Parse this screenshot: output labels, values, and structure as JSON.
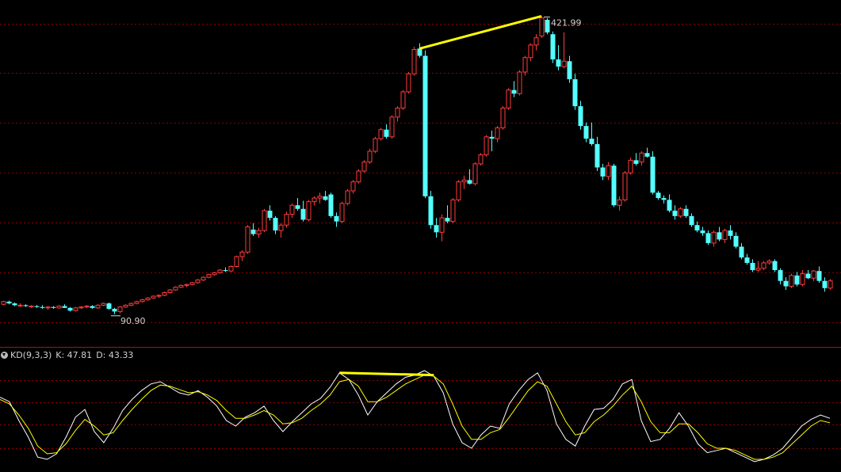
{
  "indicator": {
    "name": "KD(9,3,3)",
    "k_label": "K: 47.81",
    "d_label": "D: 43.33"
  },
  "colors": {
    "background": "#000000",
    "up": "#ff3c3c",
    "down": "#54ffff",
    "grid": "#8c0000",
    "separator": "#b01010",
    "trendline": "#ffff00",
    "k_line": "#ffffff",
    "d_line": "#ffff00",
    "label": "#d0d0d0"
  },
  "chart_data": [
    {
      "type": "candlestick",
      "title": "",
      "ylim": [
        60,
        440
      ],
      "grid": "dotted horizontal",
      "annotations": [
        {
          "text": "421.99",
          "kind": "max",
          "x": 97
        },
        {
          "text": "90.90",
          "kind": "min",
          "x": 20
        }
      ],
      "trendline": {
        "from": [
          75,
          386
        ],
        "to": [
          97,
          422
        ]
      },
      "candles": [
        [
          0,
          102,
          106,
          101,
          105
        ],
        [
          1,
          105,
          106,
          102,
          103
        ],
        [
          2,
          103,
          104,
          100,
          101
        ],
        [
          3,
          101,
          103,
          99,
          101
        ],
        [
          4,
          101,
          102,
          99,
          100
        ],
        [
          5,
          100,
          101,
          98,
          100
        ],
        [
          6,
          100,
          101,
          98,
          99
        ],
        [
          7,
          99,
          101,
          97,
          98
        ],
        [
          8,
          98,
          100,
          96,
          99
        ],
        [
          9,
          99,
          100,
          97,
          98
        ],
        [
          10,
          98,
          101,
          97,
          100
        ],
        [
          11,
          100,
          102,
          98,
          98
        ],
        [
          12,
          98,
          99,
          94,
          95
        ],
        [
          13,
          95,
          99,
          94,
          98
        ],
        [
          14,
          98,
          100,
          97,
          99
        ],
        [
          15,
          99,
          101,
          98,
          100
        ],
        [
          16,
          100,
          101,
          97,
          98
        ],
        [
          17,
          98,
          102,
          97,
          101
        ],
        [
          18,
          101,
          104,
          100,
          103
        ],
        [
          19,
          103,
          104,
          96,
          97
        ],
        [
          20,
          97,
          98,
          91,
          94
        ],
        [
          21,
          94,
          100,
          92,
          99
        ],
        [
          22,
          99,
          102,
          98,
          101
        ],
        [
          23,
          101,
          104,
          100,
          103
        ],
        [
          24,
          103,
          106,
          102,
          105
        ],
        [
          25,
          105,
          108,
          104,
          107
        ],
        [
          26,
          107,
          110,
          106,
          109
        ],
        [
          27,
          109,
          112,
          108,
          111
        ],
        [
          28,
          111,
          113,
          109,
          112
        ],
        [
          29,
          112,
          116,
          111,
          115
        ],
        [
          30,
          115,
          119,
          114,
          118
        ],
        [
          31,
          118,
          122,
          117,
          121
        ],
        [
          32,
          121,
          124,
          120,
          123
        ],
        [
          33,
          123,
          125,
          121,
          124
        ],
        [
          34,
          124,
          127,
          123,
          126
        ],
        [
          35,
          126,
          130,
          125,
          129
        ],
        [
          36,
          129,
          133,
          128,
          132
        ],
        [
          37,
          132,
          136,
          131,
          135
        ],
        [
          38,
          135,
          138,
          134,
          137
        ],
        [
          39,
          137,
          141,
          136,
          140
        ],
        [
          40,
          140,
          143,
          138,
          139
        ],
        [
          41,
          139,
          145,
          138,
          144
        ],
        [
          42,
          144,
          156,
          143,
          155
        ],
        [
          43,
          155,
          162,
          150,
          160
        ],
        [
          44,
          160,
          190,
          158,
          188
        ],
        [
          45,
          185,
          192,
          178,
          180
        ],
        [
          46,
          180,
          187,
          176,
          184
        ],
        [
          47,
          184,
          208,
          182,
          206
        ],
        [
          48,
          206,
          212,
          195,
          198
        ],
        [
          49,
          198,
          200,
          180,
          184
        ],
        [
          50,
          184,
          192,
          176,
          190
        ],
        [
          51,
          190,
          205,
          187,
          202
        ],
        [
          52,
          202,
          214,
          198,
          212
        ],
        [
          53,
          212,
          220,
          206,
          208
        ],
        [
          54,
          208,
          217,
          194,
          196
        ],
        [
          55,
          196,
          218,
          194,
          216
        ],
        [
          56,
          216,
          222,
          212,
          220
        ],
        [
          57,
          220,
          226,
          214,
          222
        ],
        [
          58,
          222,
          228,
          217,
          218
        ],
        [
          59,
          224,
          226,
          198,
          200
        ],
        [
          60,
          200,
          204,
          188,
          194
        ],
        [
          61,
          194,
          216,
          192,
          214
        ],
        [
          62,
          214,
          230,
          212,
          228
        ],
        [
          63,
          228,
          240,
          225,
          238
        ],
        [
          64,
          238,
          252,
          236,
          250
        ],
        [
          65,
          250,
          262,
          248,
          260
        ],
        [
          66,
          260,
          275,
          258,
          272
        ],
        [
          67,
          272,
          288,
          270,
          286
        ],
        [
          68,
          286,
          298,
          284,
          296
        ],
        [
          69,
          296,
          302,
          286,
          288
        ],
        [
          70,
          288,
          312,
          286,
          310
        ],
        [
          71,
          310,
          322,
          305,
          320
        ],
        [
          72,
          320,
          340,
          318,
          338
        ],
        [
          73,
          338,
          360,
          336,
          358
        ],
        [
          74,
          358,
          388,
          356,
          385
        ],
        [
          75,
          386,
          392,
          376,
          378
        ],
        [
          76,
          378,
          384,
          220,
          222
        ],
        [
          77,
          222,
          228,
          186,
          190
        ],
        [
          78,
          190,
          198,
          176,
          182
        ],
        [
          79,
          182,
          202,
          172,
          198
        ],
        [
          80,
          198,
          212,
          192,
          194
        ],
        [
          81,
          194,
          220,
          192,
          218
        ],
        [
          82,
          218,
          240,
          216,
          238
        ],
        [
          83,
          238,
          245,
          230,
          240
        ],
        [
          84,
          240,
          252,
          235,
          236
        ],
        [
          85,
          236,
          260,
          234,
          258
        ],
        [
          86,
          258,
          270,
          256,
          268
        ],
        [
          87,
          268,
          290,
          266,
          288
        ],
        [
          88,
          288,
          295,
          272,
          286
        ],
        [
          89,
          286,
          300,
          282,
          298
        ],
        [
          90,
          298,
          322,
          296,
          320
        ],
        [
          91,
          320,
          342,
          318,
          340
        ],
        [
          92,
          340,
          350,
          332,
          336
        ],
        [
          93,
          336,
          362,
          334,
          360
        ],
        [
          94,
          360,
          378,
          356,
          376
        ],
        [
          95,
          376,
          392,
          372,
          390
        ],
        [
          96,
          390,
          402,
          384,
          398
        ],
        [
          97,
          400,
          422,
          398,
          420
        ],
        [
          98,
          418,
          420,
          402,
          404
        ],
        [
          99,
          402,
          405,
          370,
          374
        ],
        [
          100,
          374,
          390,
          362,
          366
        ],
        [
          101,
          366,
          404,
          364,
          372
        ],
        [
          102,
          372,
          378,
          348,
          352
        ],
        [
          103,
          352,
          358,
          318,
          322
        ],
        [
          104,
          322,
          328,
          296,
          300
        ],
        [
          105,
          300,
          304,
          282,
          286
        ],
        [
          106,
          286,
          304,
          278,
          280
        ],
        [
          107,
          280,
          288,
          250,
          254
        ],
        [
          108,
          254,
          258,
          240,
          244
        ],
        [
          109,
          244,
          260,
          240,
          256
        ],
        [
          110,
          256,
          258,
          210,
          212
        ],
        [
          111,
          212,
          222,
          206,
          218
        ],
        [
          112,
          218,
          250,
          216,
          248
        ],
        [
          113,
          248,
          265,
          246,
          262
        ],
        [
          114,
          262,
          270,
          256,
          258
        ],
        [
          115,
          260,
          272,
          256,
          270
        ],
        [
          116,
          270,
          276,
          265,
          266
        ],
        [
          117,
          266,
          272,
          224,
          226
        ],
        [
          118,
          226,
          228,
          218,
          220
        ],
        [
          119,
          220,
          223,
          214,
          218
        ],
        [
          120,
          218,
          224,
          204,
          206
        ],
        [
          121,
          206,
          212,
          196,
          200
        ],
        [
          122,
          200,
          210,
          198,
          208
        ],
        [
          123,
          208,
          212,
          198,
          200
        ],
        [
          124,
          200,
          203,
          188,
          190
        ],
        [
          125,
          190,
          194,
          182,
          184
        ],
        [
          126,
          184,
          188,
          178,
          181
        ],
        [
          127,
          181,
          184,
          168,
          170
        ],
        [
          128,
          170,
          184,
          166,
          182
        ],
        [
          129,
          182,
          188,
          172,
          174
        ],
        [
          130,
          174,
          186,
          170,
          184
        ],
        [
          131,
          184,
          190,
          174,
          178
        ],
        [
          132,
          178,
          182,
          164,
          166
        ],
        [
          133,
          166,
          170,
          152,
          154
        ],
        [
          134,
          154,
          158,
          146,
          148
        ],
        [
          135,
          148,
          152,
          138,
          140
        ],
        [
          136,
          140,
          150,
          138,
          142
        ],
        [
          137,
          142,
          150,
          140,
          148
        ],
        [
          138,
          148,
          152,
          146,
          150
        ],
        [
          139,
          150,
          152,
          138,
          140
        ],
        [
          140,
          140,
          142,
          124,
          128
        ],
        [
          141,
          128,
          132,
          118,
          122
        ],
        [
          142,
          122,
          136,
          120,
          134
        ],
        [
          143,
          134,
          138,
          122,
          124
        ],
        [
          144,
          124,
          140,
          122,
          136
        ],
        [
          145,
          136,
          140,
          130,
          131
        ],
        [
          146,
          131,
          140,
          128,
          139
        ],
        [
          147,
          139,
          144,
          126,
          128
        ],
        [
          148,
          128,
          132,
          116,
          120
        ],
        [
          149,
          120,
          130,
          118,
          128
        ]
      ]
    },
    {
      "type": "line",
      "title": "KD(9,3,3)",
      "ylim": [
        0,
        100
      ],
      "series": [
        {
          "name": "K",
          "values": [
            66,
            62,
            45,
            30,
            12,
            10,
            15,
            30,
            48,
            55,
            35,
            25,
            38,
            54,
            64,
            72,
            78,
            80,
            75,
            70,
            68,
            72,
            66,
            58,
            45,
            40,
            48,
            52,
            58,
            45,
            35,
            44,
            52,
            60,
            65,
            75,
            88,
            82,
            68,
            50,
            62,
            70,
            78,
            84,
            86,
            90,
            85,
            70,
            42,
            25,
            20,
            32,
            40,
            38,
            60,
            72,
            82,
            88,
            72,
            42,
            28,
            22,
            40,
            55,
            56,
            64,
            78,
            82,
            45,
            26,
            28,
            38,
            52,
            40,
            24,
            16,
            18,
            20,
            16,
            12,
            8,
            10,
            14,
            20,
            30,
            40,
            46,
            50,
            47
          ]
        },
        {
          "name": "D",
          "values": [
            64,
            60,
            50,
            38,
            22,
            15,
            16,
            24,
            36,
            46,
            40,
            32,
            34,
            45,
            55,
            64,
            72,
            77,
            76,
            73,
            70,
            71,
            68,
            63,
            54,
            47,
            47,
            50,
            54,
            50,
            42,
            43,
            47,
            54,
            60,
            68,
            80,
            82,
            76,
            62,
            62,
            66,
            72,
            78,
            82,
            86,
            85,
            78,
            60,
            40,
            28,
            28,
            34,
            37,
            48,
            60,
            72,
            80,
            76,
            60,
            44,
            32,
            34,
            44,
            50,
            58,
            68,
            76,
            62,
            44,
            34,
            34,
            42,
            42,
            34,
            24,
            20,
            20,
            18,
            14,
            10,
            10,
            12,
            16,
            24,
            32,
            40,
            45,
            43
          ]
        }
      ],
      "trendline": {
        "from": [
          36,
          88
        ],
        "to": [
          46,
          86
        ]
      }
    }
  ]
}
